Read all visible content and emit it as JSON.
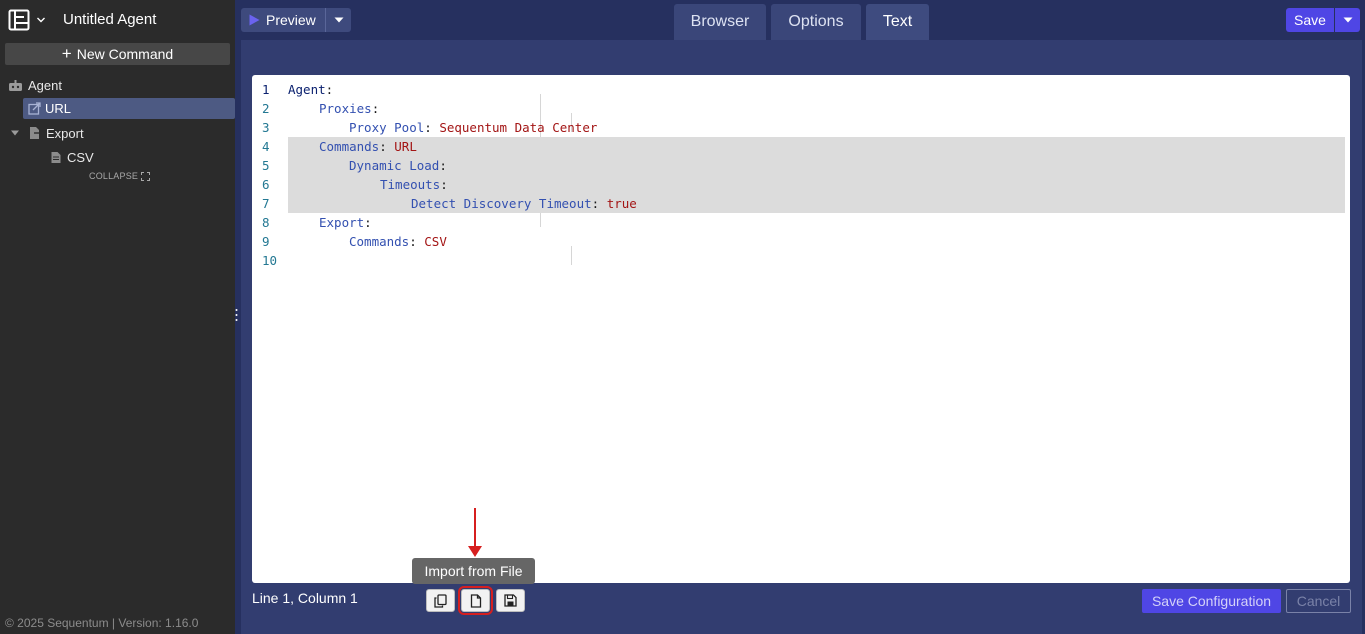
{
  "sidebar": {
    "agent_title": "Untitled Agent",
    "new_command_label": "New Command",
    "tree": {
      "agent": "Agent",
      "url": "URL",
      "export": "Export",
      "csv": "CSV"
    },
    "collapse_label": "COLLAPSE",
    "footer": "© 2025 Sequentum | Version: 1.16.0"
  },
  "toolbar": {
    "preview_label": "Preview",
    "save_label": "Save"
  },
  "tabs": {
    "browser": "Browser",
    "options": "Options",
    "text": "Text",
    "active": "Text"
  },
  "editor": {
    "lines": [
      {
        "num": "1",
        "key": "Agent",
        "value": ""
      },
      {
        "num": "2",
        "key": "Proxies",
        "value": ""
      },
      {
        "num": "3",
        "key": "Proxy Pool",
        "value": "Sequentum Data Center"
      },
      {
        "num": "4",
        "key": "Commands",
        "value": "URL"
      },
      {
        "num": "5",
        "key": "Dynamic Load",
        "value": ""
      },
      {
        "num": "6",
        "key": "Timeouts",
        "value": ""
      },
      {
        "num": "7",
        "key": "Detect Discovery Timeout",
        "value": "true"
      },
      {
        "num": "8",
        "key": "Export",
        "value": ""
      },
      {
        "num": "9",
        "key": "Commands",
        "value": "CSV"
      },
      {
        "num": "10",
        "key": "",
        "value": ""
      }
    ],
    "highlighted_lines": [
      4,
      5,
      6,
      7
    ]
  },
  "status_bar": {
    "cursor_position": "Line 1, Column 1",
    "tooltip": "Import from File",
    "save_configuration_label": "Save Configuration",
    "cancel_label": "Cancel"
  },
  "colors": {
    "accent": "#4f46e5",
    "panel": "#323d70",
    "sidebar": "#2b2b2b",
    "annotation": "#d61f1f"
  }
}
